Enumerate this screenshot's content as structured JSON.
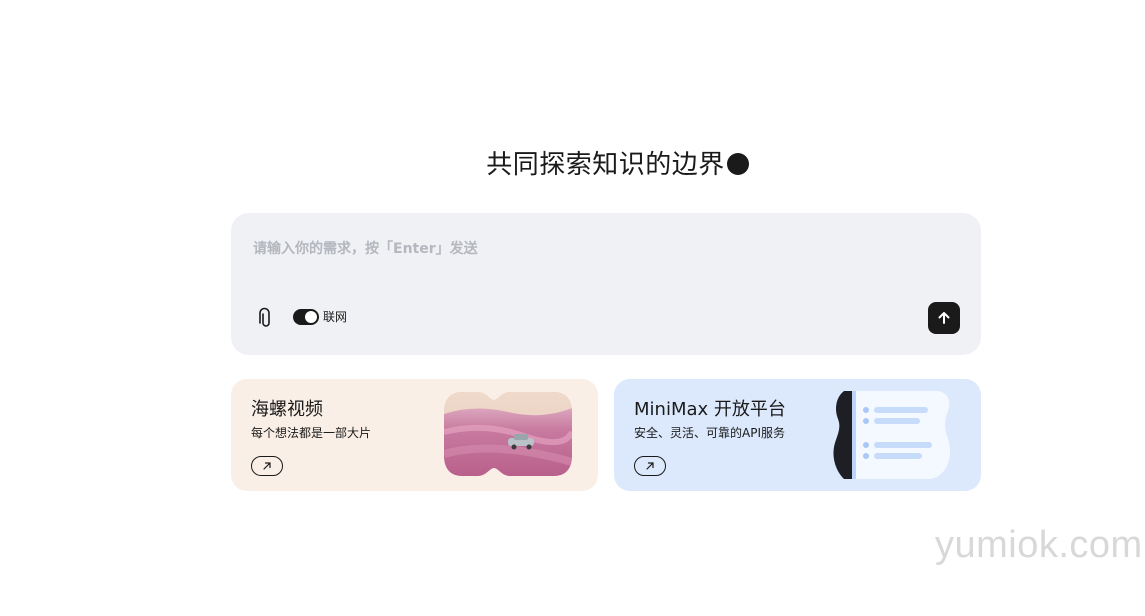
{
  "hero": {
    "headline": "共同探索知识的边界"
  },
  "composer": {
    "placeholder": "请输入你的需求，按「Enter」发送",
    "web_toggle_label": "联网",
    "web_toggle_on": true
  },
  "cards": [
    {
      "title": "海螺视频",
      "subtitle": "每个想法都是一部大片"
    },
    {
      "title": "MiniMax 开放平台",
      "subtitle": "安全、灵活、可靠的API服务"
    }
  ],
  "watermark": "yumiok.com",
  "colors": {
    "text": "#1a1a1a",
    "composer_bg": "#f0f1f5",
    "video_card_bg": "#faefe6",
    "platform_card_bg": "#dce9fd"
  },
  "icons": {
    "attach": "paperclip-icon",
    "send": "arrow-up-icon",
    "card_link": "arrow-up-right-icon"
  }
}
